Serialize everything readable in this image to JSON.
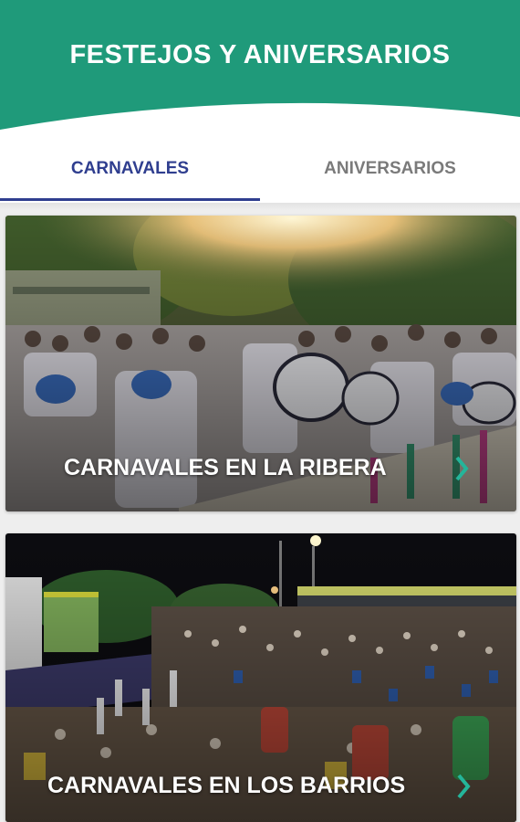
{
  "header": {
    "title": "FESTEJOS Y ANIVERSARIOS",
    "color": "#1f9a7a"
  },
  "tabs": [
    {
      "label": "CARNAVALES",
      "active": true
    },
    {
      "label": "ANIVERSARIOS",
      "active": false
    }
  ],
  "accent_color": "#2f3e8f",
  "cards": [
    {
      "label": "CARNAVALES EN LA RIBERA",
      "icon": "chevron-right-icon"
    },
    {
      "label": "CARNAVALES EN LOS BARRIOS",
      "icon": "chevron-right-icon"
    }
  ]
}
